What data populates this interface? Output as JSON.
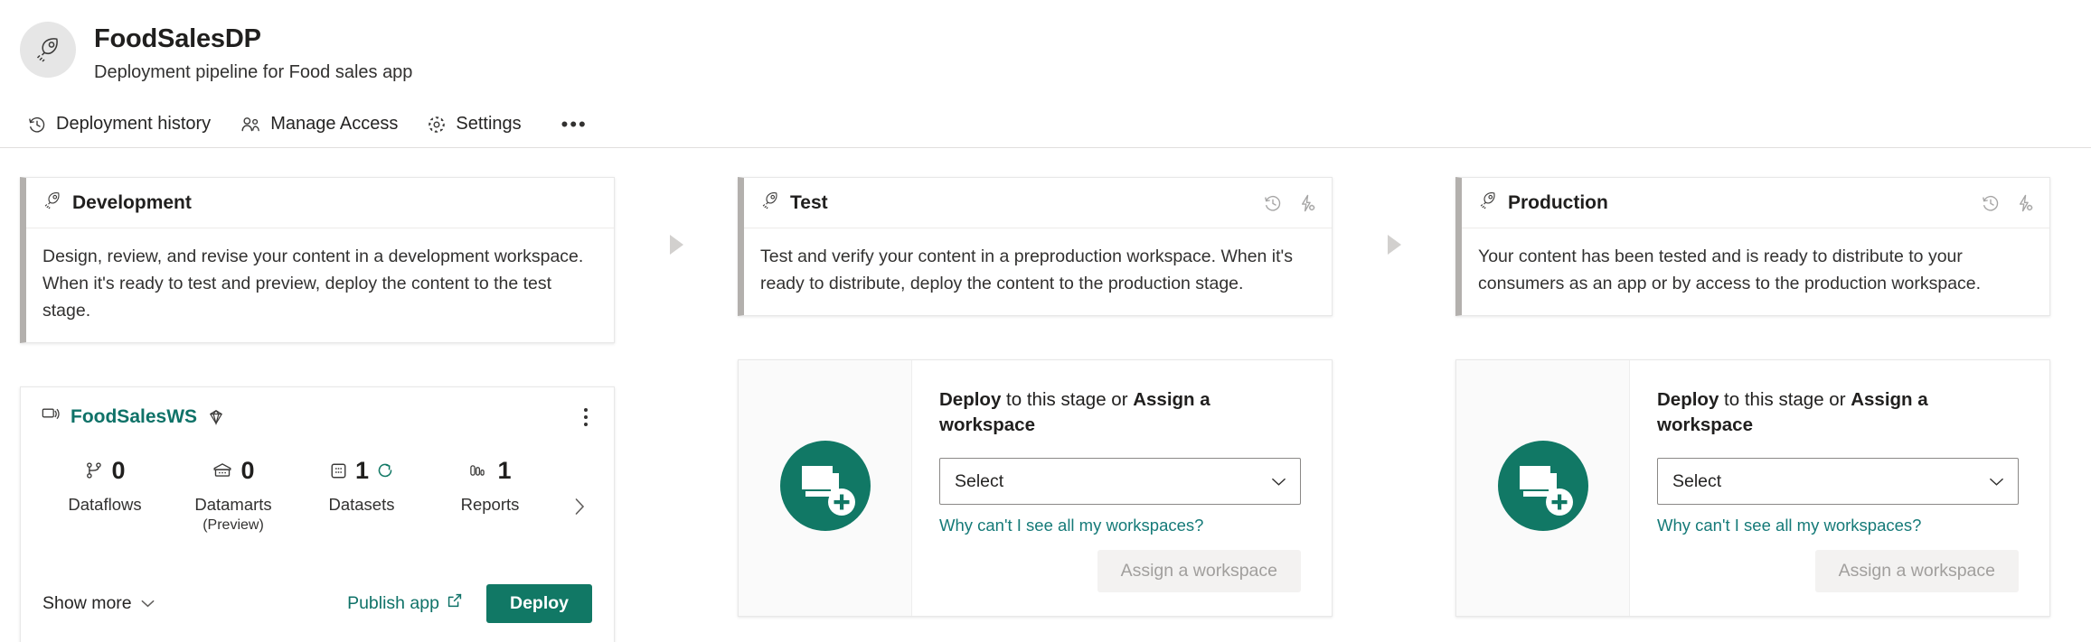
{
  "header": {
    "title": "FoodSalesDP",
    "subtitle": "Deployment pipeline for Food sales app",
    "avatar_icon": "rocket-icon"
  },
  "toolbar": {
    "items": [
      {
        "label": "Deployment history",
        "icon": "history-icon"
      },
      {
        "label": "Manage Access",
        "icon": "people-icon"
      },
      {
        "label": "Settings",
        "icon": "gear-icon"
      }
    ],
    "overflow_label": "•••"
  },
  "theme": {
    "accent_teal": "#117865",
    "link_teal": "#0f7268",
    "help_link_teal": "#157a78",
    "stage_accent_bar": "#b3b0ad",
    "disabled_button_bg": "#f3f2f1",
    "disabled_button_text": "#a19f9d",
    "connector_arrow": "#d2d0ce"
  },
  "stages": [
    {
      "name": "Development",
      "icon": "rocket-icon",
      "description": "Design, review, and revise your content in a development workspace. When it's ready to test and preview, deploy the content to the test stage.",
      "head_actions": [],
      "state": "assigned"
    },
    {
      "name": "Test",
      "icon": "rocket-icon",
      "description": "Test and verify your content in a preproduction workspace. When it's ready to distribute, deploy the content to the production stage.",
      "head_actions": [
        {
          "icon": "history-icon",
          "disabled": true
        },
        {
          "icon": "deployment-rules-icon",
          "disabled": true
        }
      ],
      "state": "empty"
    },
    {
      "name": "Production",
      "icon": "rocket-icon",
      "description": "Your content has been tested and is ready to distribute to your consumers as an app or by access to the production workspace.",
      "head_actions": [
        {
          "icon": "history-icon",
          "disabled": true
        },
        {
          "icon": "deployment-rules-icon",
          "disabled": true
        }
      ],
      "state": "empty"
    }
  ],
  "workspace_card": {
    "name": "FoodSalesWS",
    "layers_icon": "stacked-layers-icon",
    "premium_icon": "premium-diamond-icon",
    "kebab_icon": "more-options-icon",
    "metrics": [
      {
        "value": "0",
        "label": "Dataflows",
        "sublabel": "",
        "icon": "dataflow-icon",
        "refreshing": false
      },
      {
        "value": "0",
        "label": "Datamarts",
        "sublabel": "(Preview)",
        "icon": "datamart-icon",
        "refreshing": false
      },
      {
        "value": "1",
        "label": "Datasets",
        "sublabel": "",
        "icon": "dataset-icon",
        "refreshing": true
      },
      {
        "value": "1",
        "label": "Reports",
        "sublabel": "",
        "icon": "report-icon",
        "refreshing": false
      }
    ],
    "next_icon": "chevron-right-icon",
    "show_more_label": "Show more",
    "show_more_icon": "chevron-down-icon",
    "publish_app_label": "Publish app",
    "publish_app_icon": "external-link-icon",
    "deploy_label": "Deploy"
  },
  "empty_stage": {
    "art_icon": "assign-workspace-graphic",
    "heading_deploy": "Deploy",
    "heading_middle": " to this stage or ",
    "heading_assign": "Assign a workspace",
    "select_value": "Select",
    "select_chevron_icon": "chevron-down-icon",
    "help_link": "Why can't I see all my workspaces?",
    "assign_button_label": "Assign a workspace"
  }
}
